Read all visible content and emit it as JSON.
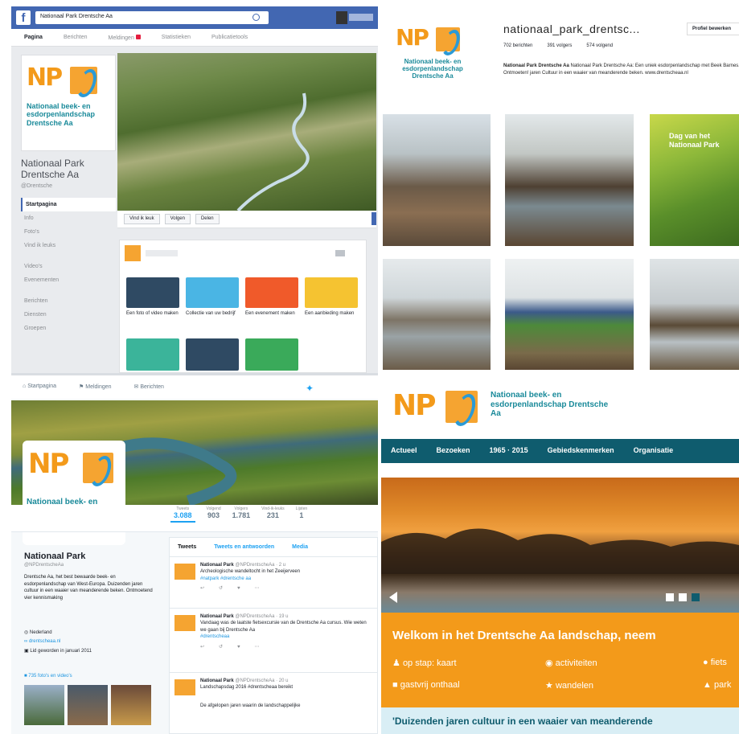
{
  "facebook": {
    "search_value": "Nationaal Park Drentsche Aa",
    "tabs": [
      "Pagina",
      "Berichten",
      "Meldingen",
      "Statistieken",
      "Publicatietools"
    ],
    "logo_text": "Nationaal beek- en esdorpenlandschap Drentsche Aa",
    "page_name": "Nationaal Park Drentsche Aa",
    "page_handle": "@Drentsche",
    "nav": [
      "Startpagina",
      "Info",
      "Foto's",
      "Vind ik leuks",
      "Video's",
      "Evenementen",
      "Berichten",
      "Diensten",
      "Groepen"
    ],
    "cover_buttons": [
      "Vind ik leuk",
      "Volgen",
      "Delen"
    ],
    "composer_tiles": [
      "Een foto of video maken",
      "Collectie van uw bedrijf",
      "Een evenement maken",
      "Een aanbieding maken"
    ],
    "colors": {
      "blue": "#3b5998",
      "bar": "#4267b2"
    }
  },
  "instagram": {
    "username": "nationaal_park_drentsc...",
    "profile_button": "Profiel bewerken",
    "stats": [
      "702 berichten",
      "391 volgers",
      "574 volgend"
    ],
    "bio_name": "Nationaal Park Drentsche Aa",
    "bio": "Nationaal Park Drentsche Aa: Een uniek esdorpenlandschap met Beek Barnes. Ontmoeten! jaren Cultuur in een waaier van meanderende beken. www.drentscheaa.nl",
    "logo_text": "Nationaal beek- en esdorpenlandschap Drentsche Aa",
    "photo_caption": "Dag van het Nationaal Park"
  },
  "twitter": {
    "tabs": [
      "Startpagina",
      "Meldingen",
      "Berichten"
    ],
    "logo_text": "Nationaal beek- en esdorpenlandschap Drentsche Aa",
    "stats": [
      {
        "label": "Tweets",
        "value": "3.088"
      },
      {
        "label": "Volgend",
        "value": "903"
      },
      {
        "label": "Volgers",
        "value": "1.781"
      },
      {
        "label": "Vind-ik-leuks",
        "value": "231"
      },
      {
        "label": "Lijsten",
        "value": "1"
      }
    ],
    "profile_name": "Nationaal Park",
    "profile_handle": "@NPDrentscheAa",
    "bio": "Drentsche Aa, het best bewaarde beek- en esdorpenlandschap van West-Europa. Duizenden jaren cultuur in een waaier van meanderende beken. Ontmoetend vier kennismaking",
    "meta": [
      "Nederland",
      "drentscheaa.nl",
      "Lid geworden in januari 2011"
    ],
    "media_link": "735 foto's en video's",
    "feed_tabs": [
      "Tweets",
      "Tweets en antwoorden",
      "Media"
    ],
    "tweets": [
      {
        "author": "Nationaal Park",
        "handle": "@NPDrentscheAa · 2 u",
        "text": "Archeologische wandeltocht in het Zeeijerveen",
        "link": "#natpark #drentsche aa"
      },
      {
        "author": "Nationaal Park",
        "handle": "@NPDrentscheAa · 19 u",
        "text": "Vandaag was de laatste fietsexcursie van de Drentsche Aa cursus. Wie weten we gaan bij Drentsche Aa",
        "link": "#drentscheaa"
      },
      {
        "author": "Nationaal Park",
        "handle": "@NPDrentscheAa · 20 u",
        "text": "Landschapsdag 2016 #drentscheaa bereikt",
        "link": ""
      }
    ],
    "bottom_text": "De afgelopen jaren waarin de landschappelijke"
  },
  "website": {
    "logo_text": "Nationaal beek- en esdorpenlandschap Drentsche Aa",
    "nav": [
      "Actueel",
      "Bezoeken",
      "1965 · 2015",
      "Gebiedskenmerken",
      "Organisatie"
    ],
    "welcome": "Welkom in het Drentsche Aa landschap, neem",
    "quicklinks": [
      "op stap: kaart",
      "activiteiten",
      "fiets",
      "gastvrij onthaal",
      "wandelen",
      "park"
    ],
    "tagline": "'Duizenden jaren cultuur in een waaier van meanderende",
    "colors": {
      "teal": "#0f5c6e",
      "orange": "#f39a1a",
      "tagline_bg": "#d9eef5"
    }
  }
}
